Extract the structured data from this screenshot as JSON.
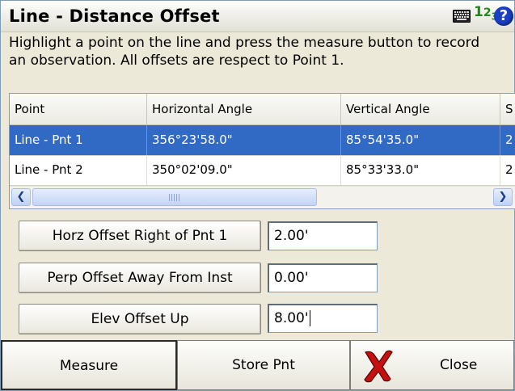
{
  "window": {
    "title": "Line - Distance Offset",
    "icons": [
      "keyboard-icon",
      "numeric-input-icon",
      "help-icon"
    ],
    "numeric_icon_text": "1",
    "numeric_icon_sub": "2",
    "numeric_icon_tail": "3",
    "help_glyph": "?"
  },
  "instructions": "Highlight a point on the line and press the measure button to record an observation. All offsets are respect to Point 1.",
  "grid": {
    "columns": [
      "Point",
      "Horizontal Angle",
      "Vertical Angle",
      "S"
    ],
    "rows": [
      {
        "point": "Line - Pnt 1",
        "hz": "356°23'58.0\"",
        "va": "85°54'35.0\"",
        "s": "2",
        "selected": true
      },
      {
        "point": "Line - Pnt 2",
        "hz": "350°02'09.0\"",
        "va": "85°33'33.0\"",
        "s": "2",
        "selected": false
      }
    ]
  },
  "offsets": [
    {
      "label": "Horz Offset Right of Pnt 1",
      "value": "2.00'"
    },
    {
      "label": "Perp Offset Away From Inst",
      "value": "0.00'"
    },
    {
      "label": "Elev Offset Up",
      "value": "8.00'"
    }
  ],
  "buttons": {
    "measure": "Measure",
    "store": "Store Pnt",
    "close": "Close"
  },
  "colors": {
    "selection": "#316ac5",
    "help": "#1a3fc4",
    "numeric": "#1c8a1c",
    "close_x": "#c41010"
  }
}
